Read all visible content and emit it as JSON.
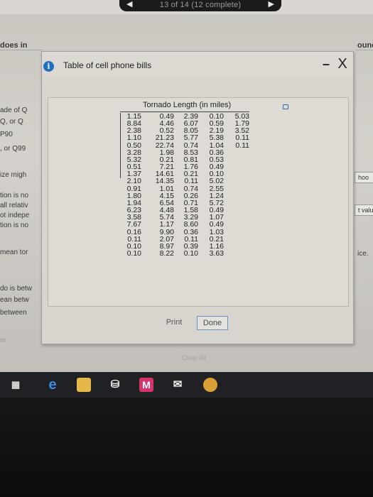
{
  "nav": {
    "progress_label": "13 of 14 (12 complete)",
    "prev_arrow": "◀",
    "next_arrow": "▶"
  },
  "background": {
    "left_fragments": [
      "ade of Q",
      "Q, or Q",
      "P90",
      ", or Q99",
      "ize migh",
      "tion is no",
      "all relativ",
      "ot indepe",
      "tion is no",
      "mean tor",
      "do is betw",
      "ean betw",
      "between",
      "er"
    ],
    "does_in": "does in",
    "right_fragments": [
      "ound",
      "hoo",
      "t valu",
      "ice."
    ]
  },
  "dialog": {
    "title": "Table of cell phone bills",
    "info_icon": "info-icon",
    "minimize_label": "–",
    "close_label": "X",
    "table_title": "Tornado Length (in miles)",
    "columns": [
      [
        "1.15",
        "8.84",
        "2.38",
        "1.10",
        "0.50",
        "3.28",
        "5.32",
        "0.51",
        "1.37",
        "2.10",
        "0.91",
        "1.80",
        "1.94",
        "6.23",
        "3.58",
        "7.67",
        "0.16",
        "0.11",
        "0.10",
        "0.10"
      ],
      [
        "0.49",
        "4.46",
        "0.52",
        "21.23",
        "22.74",
        "1.98",
        "0.21",
        "7.21",
        "14.61",
        "14.35",
        "1.01",
        "4.15",
        "6.54",
        "4.48",
        "5.74",
        "1.17",
        "9.90",
        "2.07",
        "8.97",
        "8.22"
      ],
      [
        "2.39",
        "6.07",
        "8.05",
        "5.77",
        "0.74",
        "8.53",
        "0.81",
        "1.76",
        "0.21",
        "0.11",
        "0.74",
        "0.26",
        "0.71",
        "1.58",
        "3.29",
        "8.60",
        "0.36",
        "0.11",
        "0.39",
        "0.10"
      ],
      [
        "0.10",
        "0.59",
        "2.19",
        "5.38",
        "1.04",
        "0.36",
        "0.53",
        "0.49",
        "0.10",
        "5.02",
        "2.55",
        "1.24",
        "5.72",
        "0.49",
        "1.07",
        "0.49",
        "1.03",
        "0.21",
        "1.16",
        "3.63"
      ],
      [
        "5.03",
        "1.79",
        "3.52",
        "0.11",
        "0.11"
      ]
    ],
    "print_label": "Print",
    "done_label": "Done"
  },
  "clear_all_label": "Clear All",
  "taskbar_icons": [
    "task-view-icon",
    "edge-icon",
    "file-explorer-icon",
    "store-icon",
    "mail-icon",
    "photos-icon",
    "chrome-icon"
  ]
}
